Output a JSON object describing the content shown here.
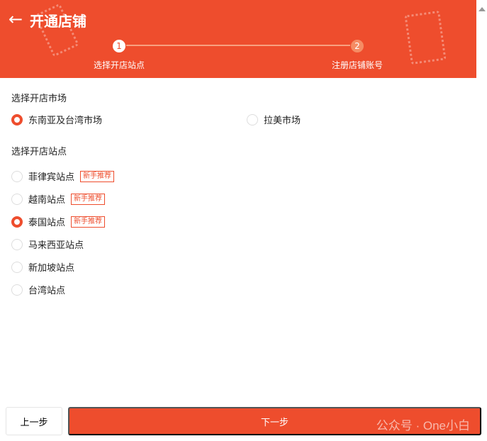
{
  "header": {
    "back_icon": "arrow-left-icon",
    "title": "开通店铺"
  },
  "steps": [
    {
      "num": "1",
      "label": "选择开店站点"
    },
    {
      "num": "2",
      "label": "注册店铺账号"
    }
  ],
  "market": {
    "label": "选择开店市场",
    "options": [
      {
        "label": "东南亚及台湾市场",
        "selected": true
      },
      {
        "label": "拉美市场",
        "selected": false
      }
    ]
  },
  "site": {
    "label": "选择开店站点",
    "tag": "新手推荐",
    "options": [
      {
        "label": "菲律宾站点",
        "selected": false,
        "tag": true
      },
      {
        "label": "越南站点",
        "selected": false,
        "tag": true
      },
      {
        "label": "泰国站点",
        "selected": true,
        "tag": true
      },
      {
        "label": "马来西亚站点",
        "selected": false
      },
      {
        "label": "新加坡站点",
        "selected": false
      },
      {
        "label": "台湾站点",
        "selected": false
      }
    ]
  },
  "footer": {
    "prev": "上一步",
    "next": "下一步",
    "watermark": "公众号 · One小白"
  },
  "colors": {
    "accent": "#ee4d2d"
  }
}
